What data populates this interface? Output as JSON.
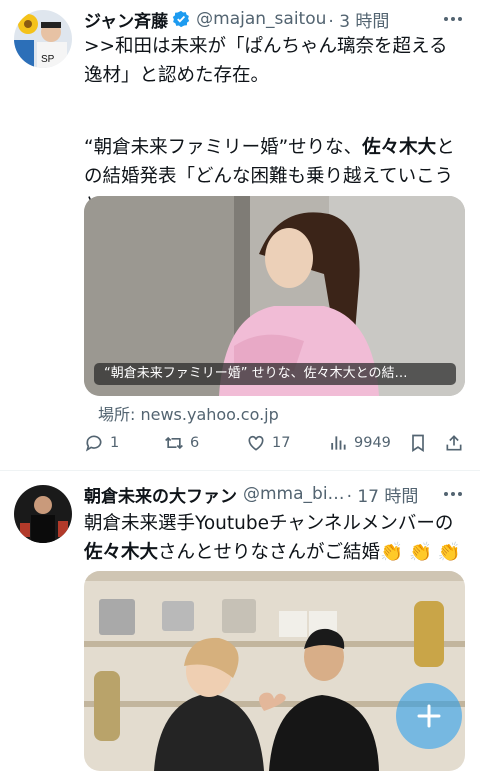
{
  "tweets": [
    {
      "author": "ジャン斉藤",
      "handle": "@majan_saitou",
      "time": "· 3 時間",
      "verified": true,
      "text_line1": ">>和田は未来が「ぱんちゃん璃奈を超える",
      "text_line2": "逸材」と認めた存在。",
      "text_line3": "",
      "text_line4_a": "“朝倉未来ファミリー婚”せりな、",
      "text_line4_b": "佐々木大",
      "text_line4_c": "と",
      "text_line5": "の結婚発表「どんな困難も乗り越えていこう",
      "text_line6": "と」(ENCOUNT)",
      "card_caption": "“朝倉未来ファミリー婚” せりな、佐々木大との結…",
      "source": "場所: news.yahoo.co.jp",
      "replies": "1",
      "retweets": "6",
      "likes": "17",
      "views": "9949"
    },
    {
      "author": "朝倉未来の大ファン",
      "handle": "@mma_bi…",
      "time": "· 17 時間",
      "text_line1": "朝倉未来選手Youtubeチャンネルメンバーの",
      "text_line2_a": "佐々木大",
      "text_line2_b": "さんとせりなさんがご結婚",
      "text_line2_emoji": "👏 👏 👏"
    }
  ],
  "colors": {
    "accent": "#1d9bf0",
    "muted": "#536471",
    "text": "#0f1419"
  },
  "icons": [
    "verified-badge-icon",
    "more-icon",
    "reply-icon",
    "retweet-icon",
    "like-icon",
    "views-icon",
    "bookmark-icon",
    "share-icon",
    "compose-plus-icon"
  ],
  "fab_label": "+"
}
